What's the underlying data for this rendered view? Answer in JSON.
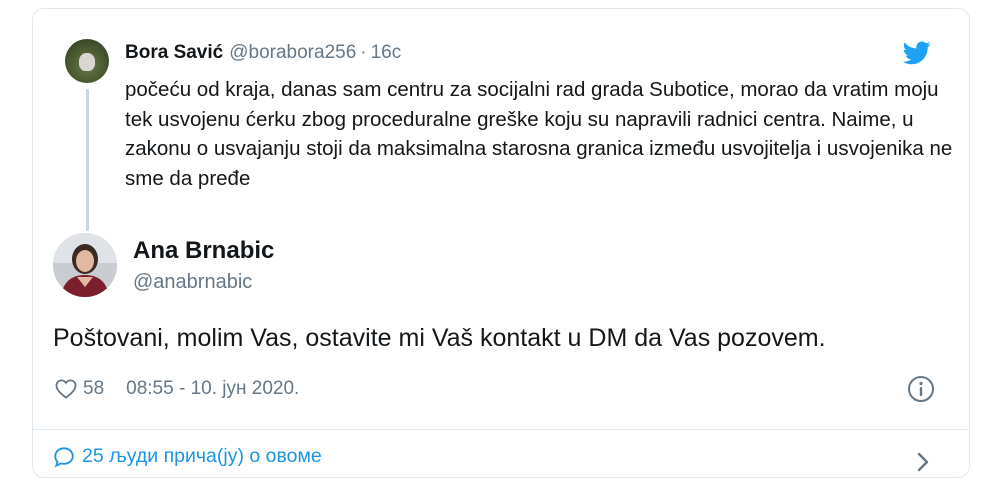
{
  "quoted_tweet": {
    "name": "Bora Savić",
    "handle": "@borabora256",
    "separator": "·",
    "time": "16с",
    "text": "počeću od kraja, danas sam centru za socijalni rad grada Subotice, morao da vratim moju tek usvojenu ćerku zbog proceduralne greške koju su napravili radnici centra. Naime, u zakonu o usvajanju stoji da maksimalna starosna granica između usvojitelja i usvojenika ne sme da pređe"
  },
  "main_tweet": {
    "name": "Ana Brnabic",
    "handle": "@anabrnabic",
    "text": "Poštovani, molim Vas, ostavite mi Vaš kontakt u DM da Vas pozovem.",
    "likes": "58",
    "timestamp": "08:55 - 10. јун 2020."
  },
  "footer": {
    "conversation_label": "25 људи прича(ју) о овоме"
  },
  "colors": {
    "twitter_blue": "#1da1f2",
    "link_blue": "#1b95e0",
    "secondary_text": "#657786",
    "border": "#e1e8ed"
  },
  "icons": [
    "twitter-bird-icon",
    "heart-icon",
    "info-icon",
    "speech-bubble-icon",
    "chevron-right-icon"
  ]
}
